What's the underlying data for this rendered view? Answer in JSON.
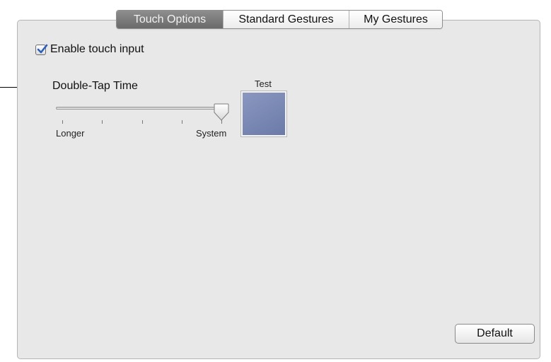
{
  "tabs": [
    {
      "label": "Touch Options",
      "selected": true
    },
    {
      "label": "Standard Gestures",
      "selected": false
    },
    {
      "label": "My Gestures",
      "selected": false
    }
  ],
  "touch_options": {
    "enable_touch_input": {
      "label": "Enable touch input",
      "checked": true
    },
    "double_tap_time": {
      "label": "Double-Tap Time",
      "min_label": "Longer",
      "max_label": "System",
      "tick_count": 5,
      "value_fraction": 1.0
    },
    "test_area_label": "Test",
    "test_area_color": "#7584b3"
  },
  "default_button_label": "Default",
  "colors": {
    "selected_tab": "#7a7a7a",
    "panel_background": "#e8e8e8",
    "checkbox_check": "#2b5fb8"
  }
}
